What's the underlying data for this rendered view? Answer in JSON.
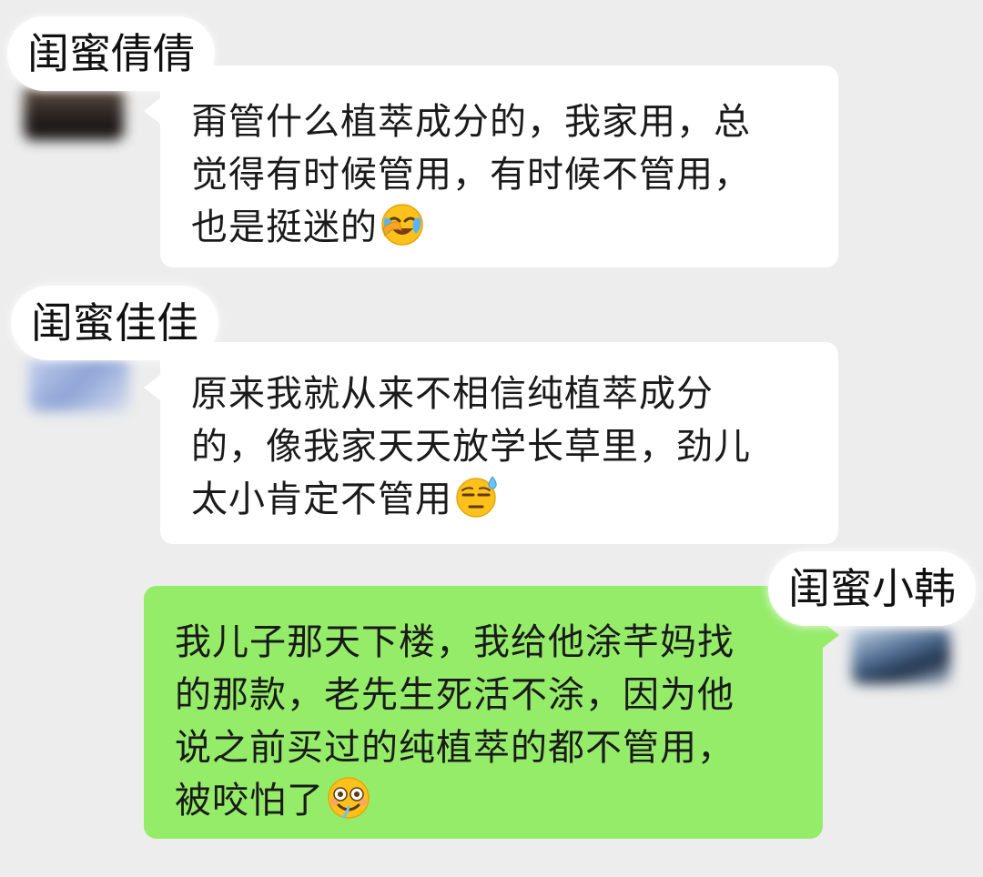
{
  "conversation": [
    {
      "sender_name": "闺蜜倩倩",
      "direction": "incoming",
      "lines": [
        "甭管什么植萃成分的，我家用，总",
        "觉得有时候管用，有时候不管用，",
        "也是挺迷的"
      ],
      "emoji": "face-with-tears-of-joy-icon",
      "avatar_color": "#2a2320"
    },
    {
      "sender_name": "闺蜜佳佳",
      "direction": "incoming",
      "lines": [
        "原来我就从来不相信纯植萃成分",
        "的，像我家天天放学长草里，劲儿",
        "太小肯定不管用"
      ],
      "emoji": "downcast-face-with-sweat-icon",
      "avatar_color": "#8ea4d6"
    },
    {
      "sender_name": "闺蜜小韩",
      "direction": "outgoing",
      "lines": [
        "我儿子那天下楼，我给他涂芊妈找",
        "的那款，老先生死活不涂，因为他",
        "说之前买过的纯植萃的都不管用，",
        "被咬怕了"
      ],
      "emoji": "woozy-smile-icon",
      "avatar_color": "#4c6a8e"
    }
  ],
  "colors": {
    "background": "#ededed",
    "incoming_bubble": "#ffffff",
    "outgoing_bubble": "#95ec69",
    "text": "#1a1a1a"
  }
}
